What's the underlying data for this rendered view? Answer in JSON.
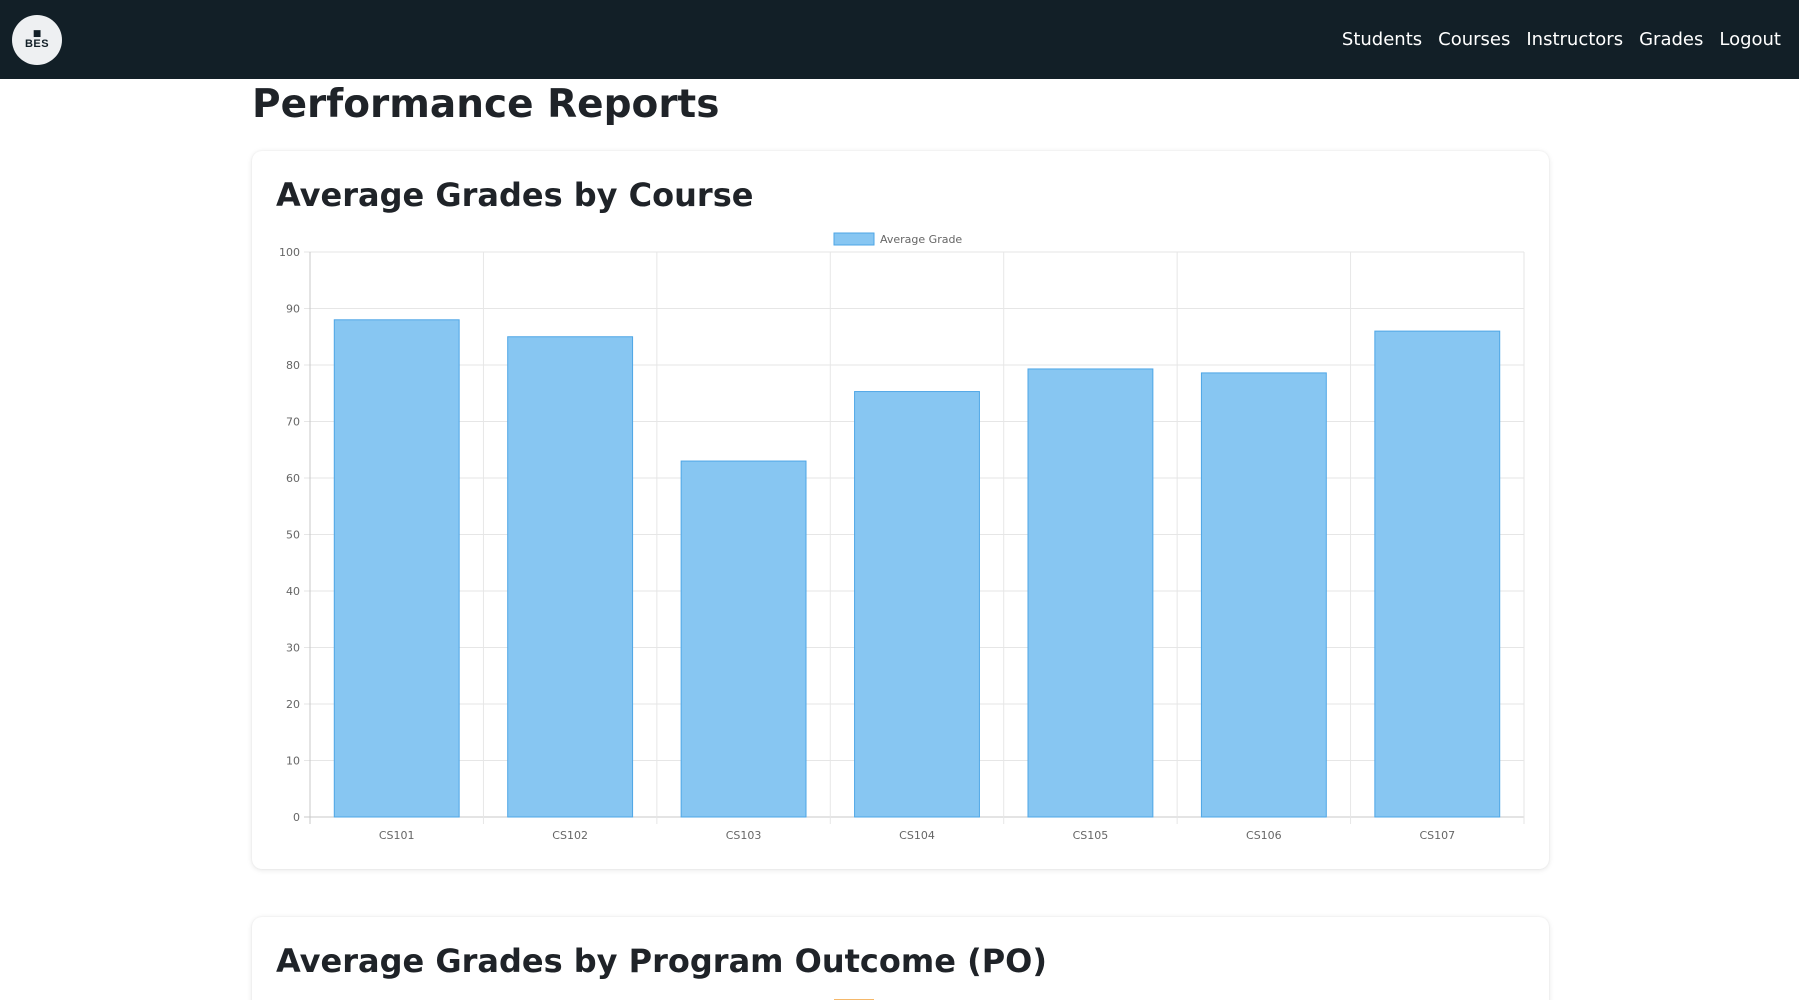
{
  "navbar": {
    "logo_text": "BES",
    "logo_icon": "book-icon",
    "links": [
      "Students",
      "Courses",
      "Instructors",
      "Grades",
      "Logout"
    ]
  },
  "page": {
    "title": "Performance Reports"
  },
  "cards": {
    "course_title": "Average Grades by Course",
    "po_title": "Average Grades by Program Outcome (PO)"
  },
  "colors": {
    "navbar_bg": "#121f27",
    "bar_fill": "#87c6f2",
    "bar_border": "#4ea6e6",
    "legend_orange": "#f5b86a"
  },
  "chart_data": {
    "type": "bar",
    "categories": [
      "CS101",
      "CS102",
      "CS103",
      "CS104",
      "CS105",
      "CS106",
      "CS107"
    ],
    "series": [
      {
        "name": "Average Grade",
        "values": [
          88,
          85,
          63,
          75.3,
          79.3,
          78.6,
          86
        ]
      }
    ],
    "ylim": [
      0,
      100
    ],
    "yticks": [
      0,
      10,
      20,
      30,
      40,
      50,
      60,
      70,
      80,
      90,
      100
    ],
    "grid": true,
    "legend": "top-center"
  }
}
